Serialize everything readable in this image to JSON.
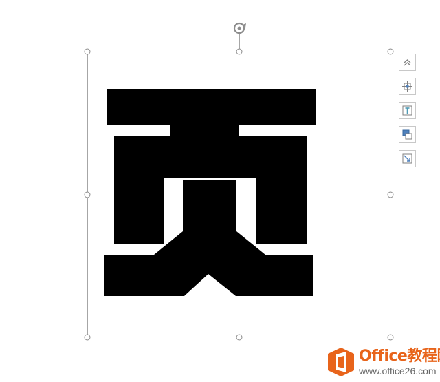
{
  "canvas": {
    "shape_glyph": "页",
    "shape_color": "#000000"
  },
  "selection": {
    "border_color": "#a6a6a6",
    "handle_count": 8,
    "rotate_icon": "rotate-icon"
  },
  "side_tools": [
    {
      "icon": "collapse-chevrons-icon"
    },
    {
      "icon": "layout-options-icon"
    },
    {
      "icon": "text-box-icon"
    },
    {
      "icon": "arrange-layers-icon"
    },
    {
      "icon": "resize-arrow-icon"
    }
  ],
  "watermark": {
    "title": "Office教程网",
    "url": "www.office26.com",
    "brand_color": "#e8641b"
  }
}
